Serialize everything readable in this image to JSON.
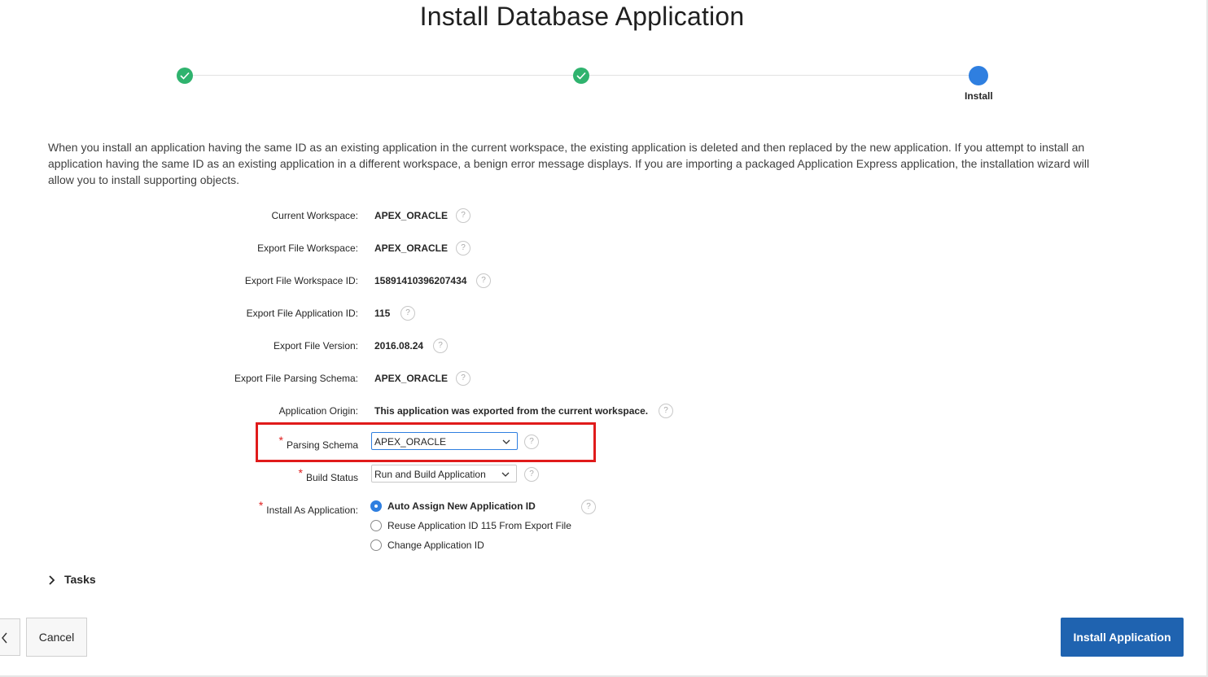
{
  "page": {
    "title": "Install Database Application"
  },
  "wizard": {
    "steps": [
      {
        "status": "complete",
        "label": ""
      },
      {
        "status": "complete",
        "label": ""
      },
      {
        "status": "current",
        "label": "Install"
      }
    ]
  },
  "intro_text": "When you install an application having the same ID as an existing application in the current workspace, the existing application is deleted and then replaced by the new application. If you attempt to install an application having the same ID as an existing application in a different workspace, a benign error message displays. If you are importing a packaged Application Express application, the installation wizard will allow you to install supporting objects.",
  "fields": {
    "current_workspace": {
      "label": "Current Workspace:",
      "value": "APEX_ORACLE"
    },
    "export_file_workspace": {
      "label": "Export File Workspace:",
      "value": "APEX_ORACLE"
    },
    "export_file_workspace_id": {
      "label": "Export File Workspace ID:",
      "value": "15891410396207434"
    },
    "export_file_application_id": {
      "label": "Export File Application ID:",
      "value": "115"
    },
    "export_file_version": {
      "label": "Export File Version:",
      "value": "2016.08.24"
    },
    "export_file_parsing_schema": {
      "label": "Export File Parsing Schema:",
      "value": "APEX_ORACLE"
    },
    "application_origin": {
      "label": "Application Origin:",
      "value": "This application was exported from the current workspace."
    },
    "parsing_schema": {
      "label": "Parsing Schema",
      "required_marker": "*",
      "value": "APEX_ORACLE"
    },
    "build_status": {
      "label": "Build Status",
      "required_marker": "*",
      "value": "Run and Build Application"
    },
    "install_as_application": {
      "label": "Install As Application:",
      "required_marker": "*",
      "options": [
        {
          "label": "Auto Assign New Application ID",
          "selected": true
        },
        {
          "label": "Reuse Application ID 115 From Export File",
          "selected": false
        },
        {
          "label": "Change Application ID",
          "selected": false
        }
      ]
    }
  },
  "help_icon_glyph": "?",
  "tasks": {
    "label": "Tasks"
  },
  "buttons": {
    "previous_glyph": "‹",
    "cancel": "Cancel",
    "install": "Install Application"
  },
  "colors": {
    "step_complete": "#2fb36e",
    "step_current": "#2f7fe0",
    "primary_button": "#1f63b0",
    "required": "#e02020",
    "highlight_box": "#e01b1b"
  }
}
